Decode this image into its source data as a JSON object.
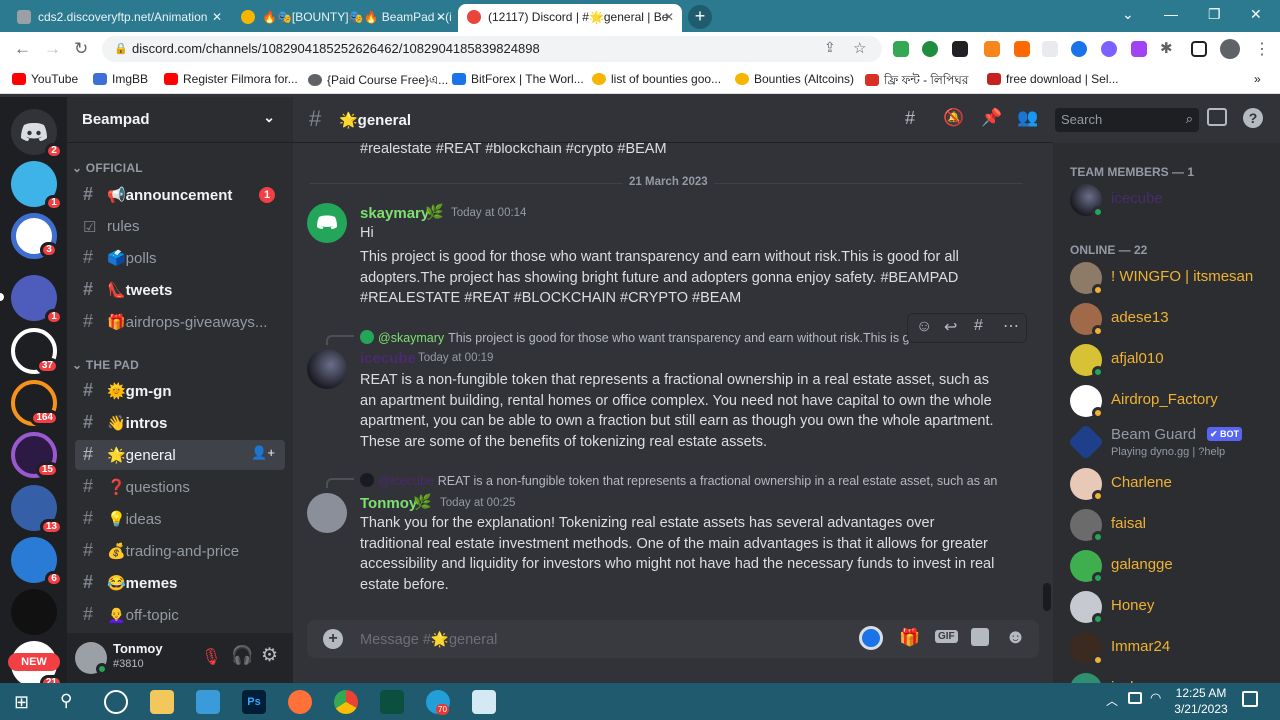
{
  "browser": {
    "tabs": [
      {
        "title": "cds2.discoveryftp.net/Animation"
      },
      {
        "title": "🔥🎭[BOUNTY]🎭🔥 BeamPad - (i"
      },
      {
        "title": "(12117) Discord | #🌟general | Be"
      }
    ],
    "url": "discord.com/channels/1082904185252626462/1082904185839824898",
    "bookmarks": [
      "YouTube",
      "ImgBB",
      "Register Filmora for...",
      "{Paid Course Free}এ...",
      "BitForex | The Worl...",
      "list of bounties goo...",
      "Bounties (Altcoins)",
      "ফ্রি ফন্ট - লিপিঘর",
      "free download | Sel..."
    ]
  },
  "guilds": [
    {
      "badge": "2",
      "color": "#5865f2",
      "icon": "discord-home-icon"
    },
    {
      "badge": "1",
      "color": "#3db3e8",
      "icon": "server-face"
    },
    {
      "badge": "3",
      "color": "#ffffff",
      "icon": "server-shield"
    },
    {
      "badge": "1",
      "color": "#4e5dbb",
      "icon": "server-question"
    },
    {
      "badge": "37",
      "color": "#ffffff",
      "icon": "server-ring"
    },
    {
      "badge": "164",
      "color": "#f7931a",
      "icon": "server-hex"
    },
    {
      "badge": "15",
      "color": "#9b59d0",
      "icon": "server-target"
    },
    {
      "badge": "13",
      "color": "#3560a8",
      "icon": "server-globe"
    },
    {
      "badge": "6",
      "color": "#2a7bd5",
      "icon": "server-house"
    },
    {
      "badge": "",
      "color": "#111111",
      "icon": "server-bird"
    },
    {
      "badge": "21",
      "color": "#ffffff",
      "icon": "server-new"
    }
  ],
  "new_label": "NEW",
  "server": {
    "name": "Beampad",
    "categories": [
      {
        "name": "OFFICIAL"
      },
      {
        "name": "THE PAD"
      }
    ],
    "channels": [
      {
        "label": "📢announcement",
        "badge": "1"
      },
      {
        "label": "rules",
        "badge": ""
      },
      {
        "label": "🗳️polls",
        "badge": ""
      },
      {
        "label": "👠tweets",
        "badge": ""
      },
      {
        "label": "🎁airdrops-giveaways...",
        "badge": ""
      },
      {
        "label": "🌞gm-gn",
        "badge": ""
      },
      {
        "label": "👋intros",
        "badge": ""
      },
      {
        "label": "🌟general",
        "badge": ""
      },
      {
        "label": "❓questions",
        "badge": ""
      },
      {
        "label": "💡ideas",
        "badge": ""
      },
      {
        "label": "💰trading-and-price",
        "badge": ""
      },
      {
        "label": "😂memes",
        "badge": ""
      },
      {
        "label": "👩‍🦲off-topic",
        "badge": ""
      }
    ]
  },
  "user": {
    "name": "Tonmoy",
    "tag": "#3810"
  },
  "chat": {
    "channel": "🌟general",
    "search_placeholder": "Search",
    "composer_placeholder": "Message #🌟general",
    "gif_label": "GIF",
    "top_line": "#realestate #REAT #blockchain #crypto #BEAM",
    "divider": "21 March 2023",
    "messages": [
      {
        "author": "skaymary",
        "author_color": "#7ee06f",
        "time": "Today at 00:14",
        "lines": [
          "Hi",
          "This project is good for those who want transparency and earn without risk.This is good for all adopters.The project has showing bright future and adopters gonna enjoy safety. #BEAMPAD #REALESTATE #REAT #BLOCKCHAIN #CRYPTO #BEAM"
        ]
      },
      {
        "reply_author": "@skaymary",
        "reply_text": "This project is good for those who want transparency and earn without risk.This is g",
        "author": "icecube",
        "author_color": "#4b2a6e",
        "time": "Today at 00:19",
        "lines": [
          "REAT is a non-fungible token that represents a fractional ownership in a real estate asset, such as an apartment building, rental homes or office complex. You need not have capital to own the whole apartment, you can be able to own a fraction but still earn as though you own the whole apartment. These are some of the benefits of tokenizing real estate assets."
        ]
      },
      {
        "reply_author": "@icecube",
        "reply_text": "REAT is a non-fungible token that represents a fractional ownership in a real estate asset, such as an",
        "author": "Tonmoy",
        "author_color": "#7ee06f",
        "time": "Today at 00:25",
        "lines": [
          "Thank you for the explanation! Tokenizing real estate assets has several advantages over traditional real estate investment methods. One of the main advantages is that it allows for greater accessibility and liquidity for investors who might not have had the necessary funds to invest in real estate before."
        ]
      }
    ]
  },
  "members": {
    "team_header": "TEAM MEMBERS — 1",
    "online_header": "ONLINE — 22",
    "team": [
      {
        "name": "icecube",
        "color": "#4b2a6e",
        "status": "#23a55a"
      }
    ],
    "online": [
      {
        "name": "! WINGFO | itsmesan",
        "color": "#f0b232",
        "status": "#f0b232"
      },
      {
        "name": "adese13",
        "color": "#f0b232",
        "status": "#f0b232"
      },
      {
        "name": "afjal010",
        "color": "#f0b232",
        "status": "#23a55a"
      },
      {
        "name": "Airdrop_Factory",
        "color": "#f0b232",
        "status": "#f0b232"
      },
      {
        "name": "Beam Guard",
        "color": "#949ba4",
        "status": "",
        "bot": "✔ BOT",
        "activity": "Playing dyno.gg | ?help"
      },
      {
        "name": "Charlene",
        "color": "#f0b232",
        "status": "#f0b232"
      },
      {
        "name": "faisal",
        "color": "#f0b232",
        "status": "#23a55a"
      },
      {
        "name": "galangge",
        "color": "#f0b232",
        "status": "#23a55a"
      },
      {
        "name": "Honey",
        "color": "#f0b232",
        "status": "#23a55a"
      },
      {
        "name": "Immar24",
        "color": "#f0b232",
        "status": "#f0b232"
      },
      {
        "name": "jackzzone",
        "color": "#f0b232",
        "status": ""
      }
    ]
  },
  "taskbar": {
    "time": "12:25 AM",
    "date": "3/21/2023",
    "telegram_badge": "70"
  }
}
